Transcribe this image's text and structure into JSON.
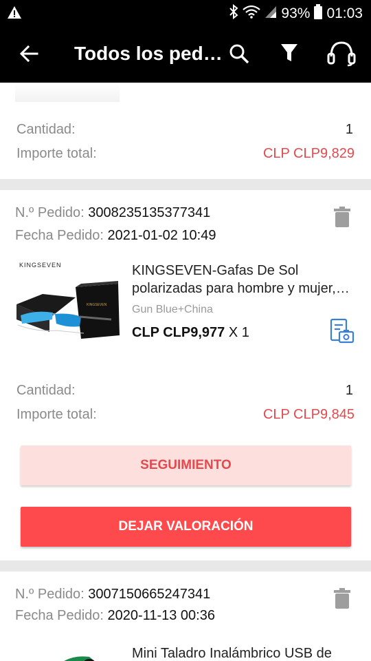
{
  "status": {
    "battery": "93%",
    "time": "01:03"
  },
  "appbar": {
    "title": "Todos los ped…"
  },
  "orders": [
    {
      "quantity_label": "Cantidad:",
      "quantity": "1",
      "total_label": "Importe total:",
      "total": "CLP CLP9,829"
    },
    {
      "order_label": "N.º Pedido:",
      "order_no": "3008235135377341",
      "date_label": "Fecha Pedido:",
      "date": "2021-01-02 10:49",
      "brand": "KINGSEVEN",
      "product_name": "KINGSEVEN-Gafas De Sol polarizadas para hombre y mujer,…",
      "variant": "Gun Blue+China",
      "unit_price": "CLP CLP9,977",
      "qty_x": "X 1",
      "quantity_label": "Cantidad:",
      "quantity": "1",
      "total_label": "Importe total:",
      "total": "CLP CLP9,845",
      "track_button": "SEGUIMIENTO",
      "review_button": "DEJAR VALORACIÓN"
    },
    {
      "order_label": "N.º Pedido:",
      "order_no": "3007150665247341",
      "date_label": "Fecha Pedido:",
      "date": "2020-11-13 00:36",
      "product_name": "Mini Taladro Inalámbrico USB de"
    }
  ],
  "colors": {
    "accent": "#ff4a4d",
    "price": "#e5484d",
    "track_bg": "#fde0dd"
  }
}
